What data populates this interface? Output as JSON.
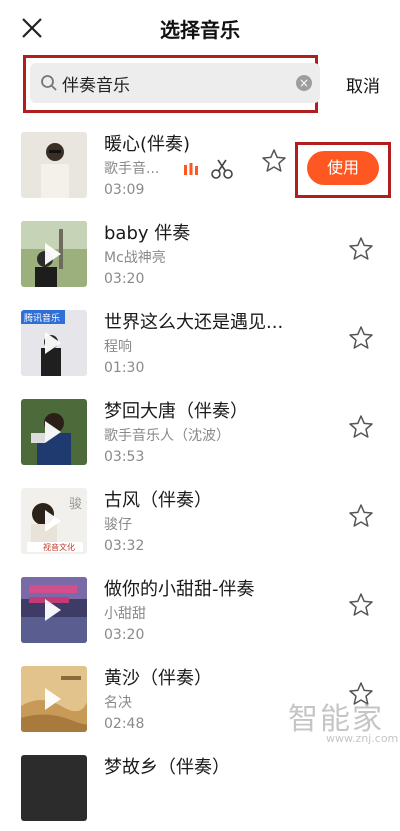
{
  "header": {
    "title": "选择音乐"
  },
  "search": {
    "value": "伴奏音乐",
    "cancel_label": "取消"
  },
  "songs": [
    {
      "title": "暖心(伴奏)",
      "artist": "歌手音...",
      "duration": "03:09",
      "use_label": "使用"
    },
    {
      "title": "baby 伴奏",
      "artist": "Mc战神亮",
      "duration": "03:20"
    },
    {
      "title": "世界这么大还是遇见...",
      "artist": "程响",
      "duration": "01:30",
      "thumb_label": "腾讯音乐"
    },
    {
      "title": "梦回大唐（伴奏）",
      "artist": "歌手音乐人（沈波）",
      "duration": "03:53"
    },
    {
      "title": "古风（伴奏）",
      "artist": "骏仔",
      "duration": "03:32",
      "thumb_text": "骏 仔",
      "thumb_label": "视音文化"
    },
    {
      "title": "做你的小甜甜-伴奏",
      "artist": "小甜甜",
      "duration": "03:20"
    },
    {
      "title": "黄沙（伴奏）",
      "artist": "名决",
      "duration": "02:48"
    },
    {
      "title": "梦故乡（伴奏）"
    }
  ],
  "watermark": {
    "main": "智能家",
    "sub": "www.znj.com"
  },
  "colors": {
    "accent": "#ff5722",
    "highlight_box": "#b01e1e"
  }
}
